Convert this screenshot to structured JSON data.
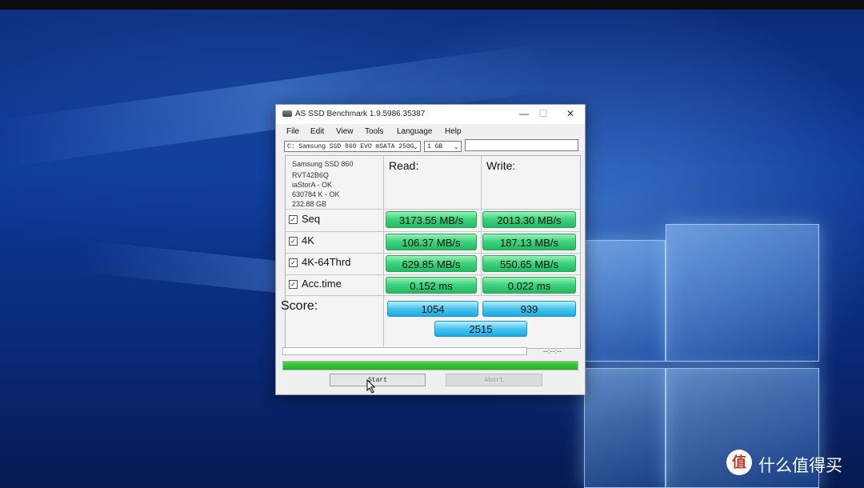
{
  "window": {
    "title": "AS SSD Benchmark 1.9.5986.35387",
    "controls": {
      "minimize": "—",
      "maximize": "☐",
      "close": "✕"
    }
  },
  "menu": [
    "File",
    "Edit",
    "View",
    "Tools",
    "Language",
    "Help"
  ],
  "toolbar": {
    "drive_select": "C: Samsung SSD 860 EVO mSATA 250G",
    "size_select": "1 GB",
    "text_field": ""
  },
  "drive_info": [
    "Samsung SSD 860",
    "RVT42B6Q",
    "iaStorA - OK",
    "630784 K - OK",
    "232.88 GB"
  ],
  "columns": {
    "read": "Read:",
    "write": "Write:"
  },
  "tests": [
    {
      "label": "Seq",
      "checked": true,
      "read": "3173.55 MB/s",
      "write": "2013.30 MB/s"
    },
    {
      "label": "4K",
      "checked": true,
      "read": "106.37 MB/s",
      "write": "187.13 MB/s"
    },
    {
      "label": "4K-64Thrd",
      "checked": true,
      "read": "629.85 MB/s",
      "write": "550.65 MB/s"
    },
    {
      "label": "Acc.time",
      "checked": true,
      "read": "0.152 ms",
      "write": "0.022 ms"
    }
  ],
  "score": {
    "label": "Score:",
    "read": "1054",
    "write": "939",
    "total": "2515"
  },
  "progress": {
    "elapsed": "--:--:--",
    "fraction": 1.0
  },
  "buttons": {
    "start": "Start",
    "abort": "Abort"
  },
  "watermark": {
    "icon": "值",
    "text": "什么值得买"
  },
  "colors": {
    "value_green": "#3fd47e",
    "score_blue": "#47c4ef",
    "progress_green": "#1fae2a",
    "desktop_blue": "#0d3a98"
  }
}
